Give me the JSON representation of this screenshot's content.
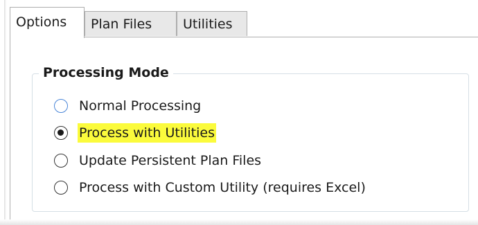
{
  "tabs": [
    {
      "label": "Options",
      "active": true
    },
    {
      "label": "Plan Files",
      "active": false
    },
    {
      "label": "Utilities",
      "active": false
    }
  ],
  "processing_mode": {
    "title": "Processing Mode",
    "options": [
      {
        "label": "Normal Processing",
        "selected": false,
        "highlighted": false
      },
      {
        "label": "Process with Utilities",
        "selected": true,
        "highlighted": true
      },
      {
        "label": "Update Persistent Plan Files",
        "selected": false,
        "highlighted": false
      },
      {
        "label": "Process with Custom Utility (requires Excel)",
        "selected": false,
        "highlighted": false
      }
    ]
  },
  "colors": {
    "highlight": "#fbfb3c",
    "hover_radio_border": "#4a86d8",
    "group_border": "#d5dfe5"
  }
}
